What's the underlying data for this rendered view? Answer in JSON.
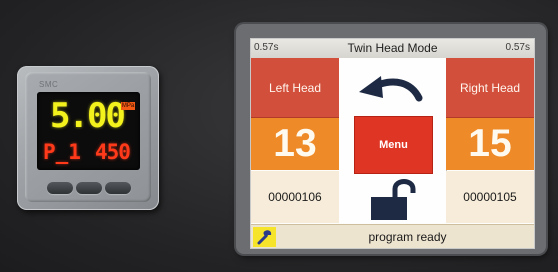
{
  "gauge": {
    "brand": "SMC",
    "main_value": "5.00",
    "unit_badge": "MPa",
    "program_label": "P_1",
    "set_value": "450",
    "colors": {
      "main": "#f4f21c",
      "secondary": "#ff3a1a",
      "unit": "#f05a14"
    }
  },
  "panel": {
    "title": "Twin Head Mode",
    "timer_left": "0.57s",
    "timer_right": "0.57s",
    "left_head": {
      "label": "Left Head",
      "count": "13",
      "serial": "00000106"
    },
    "right_head": {
      "label": "Right Head",
      "count": "15",
      "serial": "00000105"
    },
    "center": {
      "arrow_icon": "curved-arrow-left-icon",
      "menu_label": "Menu",
      "lock_icon": "unlocked-padlock-icon"
    },
    "status": {
      "wrench_icon": "wrench-icon",
      "message": "program ready"
    },
    "colors": {
      "head_label_bg": "#d24f3c",
      "count_bg": "#ee8a27",
      "serial_bg": "#f6ecd9",
      "menu_bg": "#de3525",
      "wrench_bg": "#f5e42a",
      "status_bg": "#ede4cf"
    }
  }
}
